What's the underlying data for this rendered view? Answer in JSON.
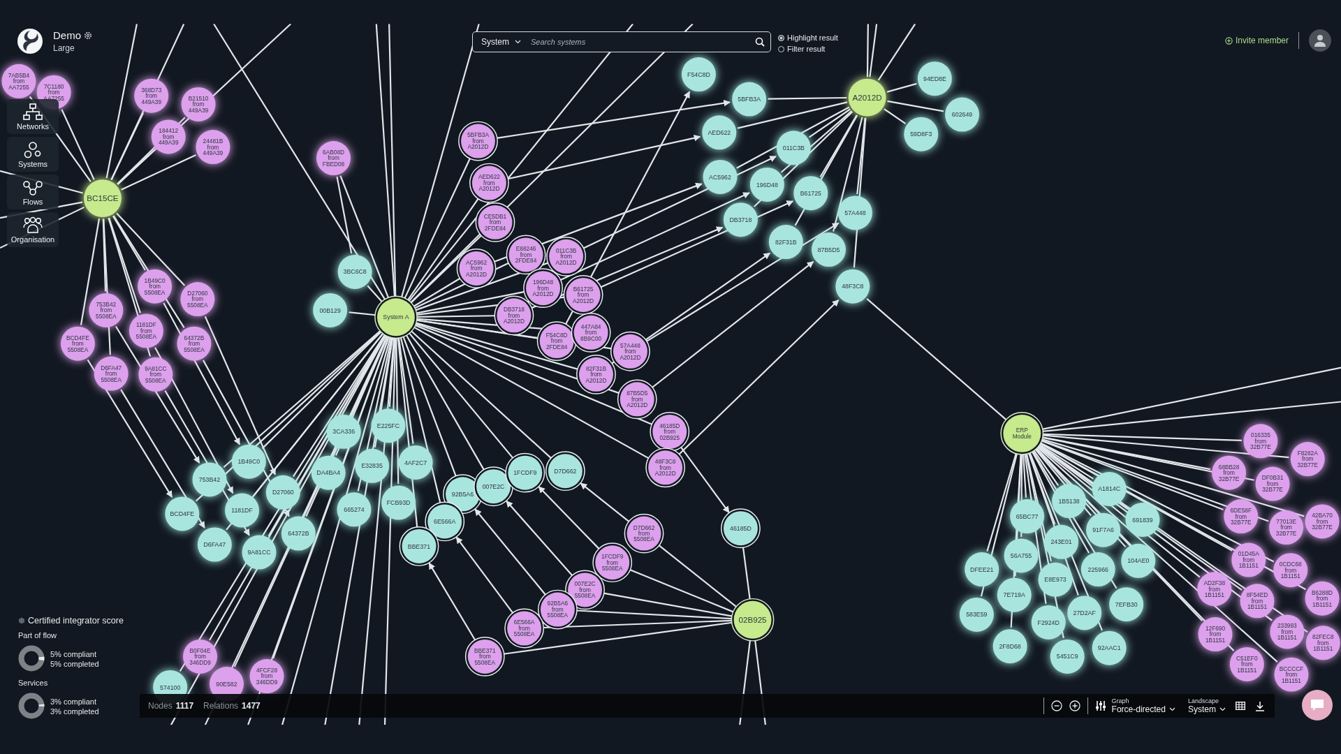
{
  "workspace": {
    "name": "Demo",
    "size": "Large"
  },
  "sidebar": {
    "items": [
      {
        "label": "Networks"
      },
      {
        "label": "Systems"
      },
      {
        "label": "Flows"
      },
      {
        "label": "Organisation"
      }
    ]
  },
  "search": {
    "scope": "System",
    "placeholder": "Search systems"
  },
  "result_mode": [
    {
      "label": "Highlight result",
      "selected": true
    },
    {
      "label": "Filter result",
      "selected": false
    }
  ],
  "invite_button": "Invite member",
  "graph": {
    "nodes": [
      {
        "kind": "hub",
        "lines": [
          "BC15CE"
        ],
        "highlighted": false
      },
      {
        "kind": "hub",
        "lines": [
          "System A"
        ],
        "highlighted": true
      },
      {
        "kind": "hub",
        "lines": [
          "A2012D"
        ],
        "highlighted": false
      },
      {
        "kind": "hub",
        "lines": [
          "ERP",
          "Module"
        ],
        "highlighted": true
      },
      {
        "kind": "hub",
        "lines": [
          "02B925"
        ],
        "highlighted": true
      },
      {
        "kind": "copy",
        "lines": [
          "7AB5B4",
          "from",
          "AA7255"
        ],
        "highlighted": false
      },
      {
        "kind": "copy",
        "lines": [
          "7C1180",
          "from",
          "AA7255"
        ],
        "highlighted": false
      },
      {
        "kind": "copy",
        "lines": [
          "368D73",
          "from",
          "449A39"
        ],
        "highlighted": false
      },
      {
        "kind": "copy",
        "lines": [
          "B21510",
          "from",
          "449A39"
        ],
        "highlighted": false
      },
      {
        "kind": "copy",
        "lines": [
          "184412",
          "from",
          "449A39"
        ],
        "highlighted": false
      },
      {
        "kind": "copy",
        "lines": [
          "24481B",
          "from",
          "449A39"
        ],
        "highlighted": false
      },
      {
        "kind": "copy",
        "lines": [
          "6AB08D",
          "from",
          "FBED08"
        ],
        "highlighted": false
      },
      {
        "kind": "copy",
        "lines": [
          "1B49C0",
          "from",
          "5508EA"
        ],
        "highlighted": false
      },
      {
        "kind": "copy",
        "lines": [
          "D27060",
          "from",
          "5508EA"
        ],
        "highlighted": false
      },
      {
        "kind": "copy",
        "lines": [
          "753B42",
          "from",
          "5508EA"
        ],
        "highlighted": false
      },
      {
        "kind": "copy",
        "lines": [
          "1181DF",
          "from",
          "5508EA"
        ],
        "highlighted": false
      },
      {
        "kind": "copy",
        "lines": [
          "BCD4FE",
          "from",
          "5508EA"
        ],
        "highlighted": false
      },
      {
        "kind": "copy",
        "lines": [
          "64372B",
          "from",
          "5508EA"
        ],
        "highlighted": false
      },
      {
        "kind": "copy",
        "lines": [
          "D6FA47",
          "from",
          "5508EA"
        ],
        "highlighted": false
      },
      {
        "kind": "copy",
        "lines": [
          "9A81CC",
          "from",
          "5508EA"
        ],
        "highlighted": false
      },
      {
        "kind": "system",
        "lines": [
          "3BC6C8"
        ],
        "highlighted": false
      },
      {
        "kind": "system",
        "lines": [
          "00B129"
        ],
        "highlighted": false
      },
      {
        "kind": "copy",
        "lines": [
          "5BFB3A",
          "from",
          "A2012D"
        ],
        "highlighted": true
      },
      {
        "kind": "copy",
        "lines": [
          "AED622",
          "from",
          "A2012D"
        ],
        "highlighted": true
      },
      {
        "kind": "copy",
        "lines": [
          "CE5DB1",
          "from",
          "2FDE84"
        ],
        "highlighted": true
      },
      {
        "kind": "copy",
        "lines": [
          "AC5962",
          "from",
          "A2012D"
        ],
        "highlighted": true
      },
      {
        "kind": "copy",
        "lines": [
          "E88246",
          "from",
          "2FDE84"
        ],
        "highlighted": true
      },
      {
        "kind": "copy",
        "lines": [
          "011C3B",
          "from",
          "A2012D"
        ],
        "highlighted": true
      },
      {
        "kind": "copy",
        "lines": [
          "196D48",
          "from",
          "A2012D"
        ],
        "highlighted": true
      },
      {
        "kind": "copy",
        "lines": [
          "B61725",
          "from",
          "A2012D"
        ],
        "highlighted": true
      },
      {
        "kind": "copy",
        "lines": [
          "DB3718",
          "from",
          "A2012D"
        ],
        "highlighted": true
      },
      {
        "kind": "copy",
        "lines": [
          "F54C8D",
          "from",
          "2FDE84"
        ],
        "highlighted": true
      },
      {
        "kind": "copy",
        "lines": [
          "447A84",
          "from",
          "8B9C00"
        ],
        "highlighted": true
      },
      {
        "kind": "copy",
        "lines": [
          "57A448",
          "from",
          "A2012D"
        ],
        "highlighted": true
      },
      {
        "kind": "copy",
        "lines": [
          "82F31B",
          "from",
          "A2012D"
        ],
        "highlighted": true
      },
      {
        "kind": "copy",
        "lines": [
          "87B5D5",
          "from",
          "A2012D"
        ],
        "highlighted": true
      },
      {
        "kind": "copy",
        "lines": [
          "46185D",
          "from",
          "02B925"
        ],
        "highlighted": true
      },
      {
        "kind": "copy",
        "lines": [
          "48F3C8",
          "from",
          "A2012D"
        ],
        "highlighted": true
      },
      {
        "kind": "system",
        "lines": [
          "F54C8D"
        ],
        "highlighted": false
      },
      {
        "kind": "system",
        "lines": [
          "5BFB3A"
        ],
        "highlighted": false
      },
      {
        "kind": "system",
        "lines": [
          "AED622"
        ],
        "highlighted": false
      },
      {
        "kind": "system",
        "lines": [
          "011C3B"
        ],
        "highlighted": false
      },
      {
        "kind": "system",
        "lines": [
          "AC5962"
        ],
        "highlighted": false
      },
      {
        "kind": "system",
        "lines": [
          "196D48"
        ],
        "highlighted": false
      },
      {
        "kind": "system",
        "lines": [
          "B61725"
        ],
        "highlighted": false
      },
      {
        "kind": "system",
        "lines": [
          "DB3718"
        ],
        "highlighted": false
      },
      {
        "kind": "system",
        "lines": [
          "57A448"
        ],
        "highlighted": false
      },
      {
        "kind": "system",
        "lines": [
          "82F31B"
        ],
        "highlighted": false
      },
      {
        "kind": "system",
        "lines": [
          "87B5D5"
        ],
        "highlighted": false
      },
      {
        "kind": "system",
        "lines": [
          "48F3C8"
        ],
        "highlighted": false
      },
      {
        "kind": "system",
        "lines": [
          "94ED8E"
        ],
        "highlighted": false
      },
      {
        "kind": "system",
        "lines": [
          "602649"
        ],
        "highlighted": false
      },
      {
        "kind": "system",
        "lines": [
          "59D8F3"
        ],
        "highlighted": false
      },
      {
        "kind": "system",
        "lines": [
          "3CA336"
        ],
        "highlighted": false
      },
      {
        "kind": "system",
        "lines": [
          "E225FC"
        ],
        "highlighted": false
      },
      {
        "kind": "system",
        "lines": [
          "1B49C0"
        ],
        "highlighted": false
      },
      {
        "kind": "system",
        "lines": [
          "753B42"
        ],
        "highlighted": false
      },
      {
        "kind": "system",
        "lines": [
          "DA4BA4"
        ],
        "highlighted": false
      },
      {
        "kind": "system",
        "lines": [
          "E32835"
        ],
        "highlighted": false
      },
      {
        "kind": "system",
        "lines": [
          "4AF2C7"
        ],
        "highlighted": false
      },
      {
        "kind": "system",
        "lines": [
          "D27060"
        ],
        "highlighted": false
      },
      {
        "kind": "system",
        "lines": [
          "BCD4FE"
        ],
        "highlighted": false
      },
      {
        "kind": "system",
        "lines": [
          "1181DF"
        ],
        "highlighted": false
      },
      {
        "kind": "system",
        "lines": [
          "665274"
        ],
        "highlighted": false
      },
      {
        "kind": "system",
        "lines": [
          "FCB93D"
        ],
        "highlighted": false
      },
      {
        "kind": "system",
        "lines": [
          "64372B"
        ],
        "highlighted": false
      },
      {
        "kind": "system",
        "lines": [
          "D6FA47"
        ],
        "highlighted": false
      },
      {
        "kind": "system",
        "lines": [
          "9A81CC"
        ],
        "highlighted": false
      },
      {
        "kind": "system",
        "lines": [
          "574100"
        ],
        "highlighted": false
      },
      {
        "kind": "system",
        "lines": [
          "92B5A6"
        ],
        "highlighted": true
      },
      {
        "kind": "system",
        "lines": [
          "007E2C"
        ],
        "highlighted": true
      },
      {
        "kind": "system",
        "lines": [
          "1FCDF9"
        ],
        "highlighted": true
      },
      {
        "kind": "system",
        "lines": [
          "D7D662"
        ],
        "highlighted": true
      },
      {
        "kind": "system",
        "lines": [
          "6E566A"
        ],
        "highlighted": true
      },
      {
        "kind": "system",
        "lines": [
          "BBE371"
        ],
        "highlighted": true
      },
      {
        "kind": "copy",
        "lines": [
          "B0F04E",
          "from",
          "346DD9"
        ],
        "highlighted": false
      },
      {
        "kind": "copy",
        "lines": [
          "4FCF28",
          "from",
          "346DD9"
        ],
        "highlighted": false
      },
      {
        "kind": "copy",
        "lines": [
          "90E582"
        ],
        "highlighted": false
      },
      {
        "kind": "copy",
        "lines": [
          "D7D662",
          "from",
          "5508EA"
        ],
        "highlighted": true
      },
      {
        "kind": "system",
        "lines": [
          "46185D"
        ],
        "highlighted": true
      },
      {
        "kind": "copy",
        "lines": [
          "1FCDF9",
          "from",
          "5508EA"
        ],
        "highlighted": true
      },
      {
        "kind": "copy",
        "lines": [
          "007E2C",
          "from",
          "5508EA"
        ],
        "highlighted": true
      },
      {
        "kind": "copy",
        "lines": [
          "92B5A6",
          "from",
          "5508EA"
        ],
        "highlighted": true
      },
      {
        "kind": "copy",
        "lines": [
          "6E566A",
          "from",
          "5508EA"
        ],
        "highlighted": true
      },
      {
        "kind": "copy",
        "lines": [
          "BBE371",
          "from",
          "5508EA"
        ],
        "highlighted": true
      },
      {
        "kind": "system",
        "lines": [
          "A1814C"
        ],
        "highlighted": false
      },
      {
        "kind": "system",
        "lines": [
          "1B5138"
        ],
        "highlighted": false
      },
      {
        "kind": "system",
        "lines": [
          "65BC77"
        ],
        "highlighted": false
      },
      {
        "kind": "system",
        "lines": [
          "691839"
        ],
        "highlighted": false
      },
      {
        "kind": "system",
        "lines": [
          "91F7A6"
        ],
        "highlighted": false
      },
      {
        "kind": "system",
        "lines": [
          "243E01"
        ],
        "highlighted": false
      },
      {
        "kind": "system",
        "lines": [
          "56A755"
        ],
        "highlighted": false
      },
      {
        "kind": "system",
        "lines": [
          "DFEE21"
        ],
        "highlighted": false
      },
      {
        "kind": "system",
        "lines": [
          "104AE0"
        ],
        "highlighted": false
      },
      {
        "kind": "system",
        "lines": [
          "225966"
        ],
        "highlighted": false
      },
      {
        "kind": "system",
        "lines": [
          "E8E973"
        ],
        "highlighted": false
      },
      {
        "kind": "system",
        "lines": [
          "7E719A"
        ],
        "highlighted": false
      },
      {
        "kind": "system",
        "lines": [
          "7EFB30"
        ],
        "highlighted": false
      },
      {
        "kind": "system",
        "lines": [
          "583E59"
        ],
        "highlighted": false
      },
      {
        "kind": "system",
        "lines": [
          "27D2AF"
        ],
        "highlighted": false
      },
      {
        "kind": "system",
        "lines": [
          "F2924D"
        ],
        "highlighted": false
      },
      {
        "kind": "system",
        "lines": [
          "2F8D68"
        ],
        "highlighted": false
      },
      {
        "kind": "system",
        "lines": [
          "5451C9"
        ],
        "highlighted": false
      },
      {
        "kind": "system",
        "lines": [
          "92AAC1"
        ],
        "highlighted": false
      },
      {
        "kind": "copy",
        "lines": [
          "016335",
          "from",
          "32B77E"
        ],
        "highlighted": false
      },
      {
        "kind": "copy",
        "lines": [
          "F8282A",
          "from",
          "32B77E"
        ],
        "highlighted": false
      },
      {
        "kind": "copy",
        "lines": [
          "68BB28",
          "from",
          "32B77E"
        ],
        "highlighted": false
      },
      {
        "kind": "copy",
        "lines": [
          "DF0B31",
          "from",
          "32B77E"
        ],
        "highlighted": false
      },
      {
        "kind": "copy",
        "lines": [
          "6DE58F",
          "from",
          "32B77E"
        ],
        "highlighted": false
      },
      {
        "kind": "copy",
        "lines": [
          "77013E",
          "from",
          "32B77E"
        ],
        "highlighted": false
      },
      {
        "kind": "copy",
        "lines": [
          "42BA70",
          "from",
          "32B77E"
        ],
        "highlighted": false
      },
      {
        "kind": "copy",
        "lines": [
          "01D45A",
          "from",
          "1B1151"
        ],
        "highlighted": false
      },
      {
        "kind": "copy",
        "lines": [
          "0CDC68",
          "from",
          "1B1151"
        ],
        "highlighted": false
      },
      {
        "kind": "copy",
        "lines": [
          "AD2F38",
          "from",
          "1B1151"
        ],
        "highlighted": false
      },
      {
        "kind": "copy",
        "lines": [
          "8F54ED",
          "from",
          "1B1151"
        ],
        "highlighted": false
      },
      {
        "kind": "copy",
        "lines": [
          "B6288D",
          "from",
          "1B1151"
        ],
        "highlighted": false
      },
      {
        "kind": "copy",
        "lines": [
          "12F690",
          "from",
          "1B1151"
        ],
        "highlighted": false
      },
      {
        "kind": "copy",
        "lines": [
          "233993",
          "from",
          "1B1151"
        ],
        "highlighted": false
      },
      {
        "kind": "copy",
        "lines": [
          "82FEC8",
          "from",
          "1B1151"
        ],
        "highlighted": false
      },
      {
        "kind": "copy",
        "lines": [
          "C51EF0",
          "from",
          "1B1151"
        ],
        "highlighted": false
      },
      {
        "kind": "copy",
        "lines": [
          "BCCCCF",
          "from",
          "1B1151"
        ],
        "highlighted": false
      }
    ]
  },
  "score_panel": {
    "title": "Certified integrator score",
    "groups": [
      {
        "name": "Part of flow",
        "level": 0.05,
        "lines": [
          "5% compliant",
          "5% completed"
        ]
      },
      {
        "name": "Services",
        "level": 0.03,
        "lines": [
          "3% compliant",
          "3% completed"
        ]
      }
    ]
  },
  "status_bar": {
    "stats": [
      {
        "label": "Nodes",
        "value": "1117"
      },
      {
        "label": "Relations",
        "value": "1477"
      }
    ],
    "graph": {
      "label": "Graph",
      "value": "Force-directed"
    },
    "landscape": {
      "label": "Landscape",
      "value": "System"
    }
  }
}
